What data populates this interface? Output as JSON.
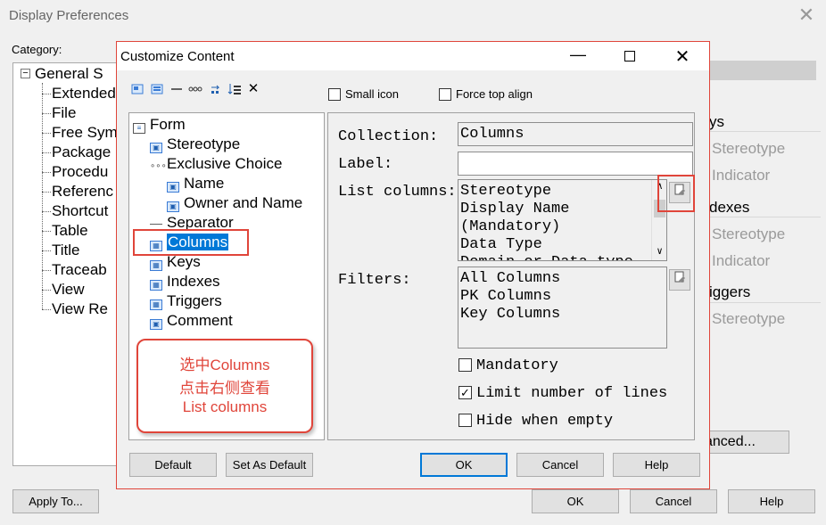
{
  "outer": {
    "title": "Display Preferences",
    "close_glyph": "✕",
    "category_label": "Category:",
    "tree": {
      "root": "General S",
      "items": [
        "Extended",
        "File",
        "Free Sym",
        "Package",
        "Procedu",
        "Referenc",
        "Shortcut",
        "Table",
        "Title",
        "Traceab",
        "View",
        "View Re"
      ]
    },
    "right_panel": {
      "keys_header": "ys",
      "keys_items": [
        "Stereotype",
        "Indicator"
      ],
      "indexes_header": "dexes",
      "indexes_items": [
        "Stereotype",
        "Indicator"
      ],
      "triggers_header": "iggers",
      "triggers_items": [
        "Stereotype"
      ]
    },
    "advanced_button": "anced...",
    "buttons": {
      "apply_to": "Apply To...",
      "ok": "OK",
      "cancel": "Cancel",
      "help": "Help"
    }
  },
  "dialog": {
    "title": "Customize Content",
    "minimize_glyph": "—",
    "close_glyph": "✕",
    "toolbar": {
      "icons": [
        "add-item-icon",
        "add-group-icon",
        "separator-icon",
        "choice-icon",
        "move-icon",
        "sort-icon",
        "delete-icon"
      ]
    },
    "small_icon_label": "Small icon",
    "force_top_align_label": "Force top align",
    "tree": {
      "form": "Form",
      "stereotype": "Stereotype",
      "exclusive_choice": "Exclusive Choice",
      "name": "Name",
      "owner_and_name": "Owner and Name",
      "separator": "Separator",
      "columns": "Columns",
      "keys": "Keys",
      "indexes": "Indexes",
      "triggers": "Triggers",
      "comment": "Comment"
    },
    "callout": {
      "line1": "选中Columns",
      "line2": "点击右侧查看",
      "line3": "List columns"
    },
    "properties": {
      "collection_label": "Collection:",
      "collection_value": "Columns",
      "label_label": "Label:",
      "label_value": "",
      "list_columns_label": "List columns:",
      "list_columns": [
        "Stereotype",
        "Display Name",
        "(Mandatory)",
        "Data Type",
        "Domain or Data type"
      ],
      "filters_label": "Filters:",
      "filters": [
        "All Columns",
        "PK Columns",
        "Key Columns"
      ],
      "mandatory_label": "Mandatory",
      "mandatory_checked": false,
      "limit_lines_label": "Limit number of lines",
      "limit_lines_checked": true,
      "hide_empty_label": "Hide when empty",
      "hide_empty_checked": false,
      "check_glyph": "✓"
    },
    "buttons": {
      "default": "Default",
      "set_as_default": "Set As Default",
      "ok": "OK",
      "cancel": "Cancel",
      "help": "Help"
    }
  },
  "colors": {
    "accent_red": "#e0453a",
    "selection_blue": "#0078d7"
  }
}
